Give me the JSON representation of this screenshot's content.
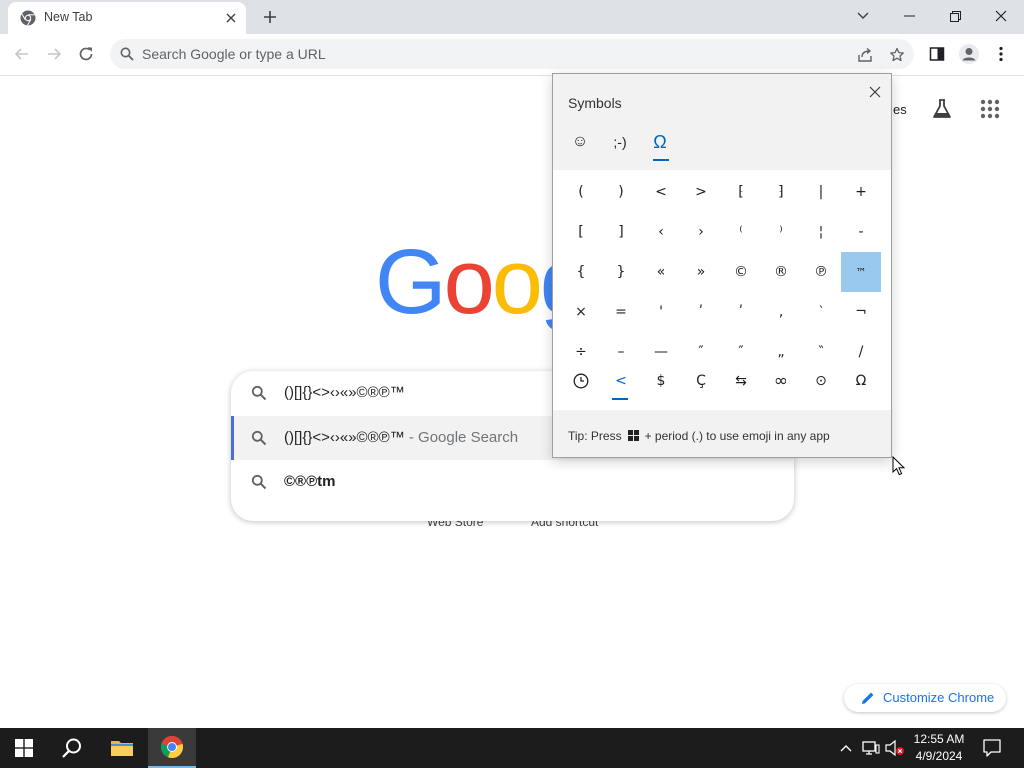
{
  "colors": {
    "accent_blue": "#1a73e8",
    "windows_accent": "#0067c0",
    "selected_symbol_bg": "#99c9ef",
    "google_blue": "#4285f4",
    "google_red": "#ea4335",
    "google_yellow": "#fbbc05",
    "taskbar_bg": "#1c1c1c"
  },
  "browser": {
    "tab_title": "New Tab",
    "omnibox_placeholder": "Search Google or type a URL"
  },
  "page": {
    "shortcuts_partial_label": "es",
    "logo_letters": [
      "G",
      "o",
      "o",
      "g"
    ],
    "web_store_label": "Web Store",
    "add_shortcut_label": "Add shortcut",
    "customize_label": "Customize Chrome"
  },
  "suggestions": [
    {
      "text": "()[]{}<>‹›«»©®℗™",
      "suffix": ""
    },
    {
      "text": "()[]{}<>‹›«»©®℗™",
      "suffix": " - Google Search"
    },
    {
      "text": "©®℗tm",
      "suffix": ""
    }
  ],
  "symbols_panel": {
    "title": "Symbols",
    "category_tabs": [
      {
        "icon": "smiley-icon",
        "label": "☺"
      },
      {
        "icon": "kaomoji-icon",
        "label": ";-)"
      },
      {
        "icon": "omega-icon",
        "label": "Ω"
      }
    ],
    "grid": [
      [
        "(",
        ")",
        "<",
        ">",
        "⁅",
        "⁆",
        "|",
        "+"
      ],
      [
        "[",
        "]",
        "‹",
        "›",
        "⁽",
        "⁾",
        "¦",
        "-"
      ],
      [
        "{",
        "}",
        "«",
        "»",
        "©",
        "®",
        "℗",
        "™"
      ],
      [
        "×",
        "=",
        "'",
        "ʹ",
        "ʹ",
        "‚",
        "‵",
        "¬"
      ],
      [
        "÷",
        "–",
        "—",
        "″",
        "″",
        "„",
        "‶",
        "/"
      ]
    ],
    "selected_symbol": "™",
    "subtabs": [
      {
        "icon": "clock-icon",
        "label": "🕒"
      },
      {
        "icon": "less-than-icon",
        "label": "<"
      },
      {
        "icon": "dollar-icon",
        "label": "$"
      },
      {
        "icon": "c-cedilla-icon",
        "label": "Ç"
      },
      {
        "icon": "arrows-icon",
        "label": "⇆"
      },
      {
        "icon": "infinity-icon",
        "label": "∞"
      },
      {
        "icon": "circled-dot-icon",
        "label": "⊙"
      },
      {
        "icon": "omega-icon",
        "label": "Ω"
      }
    ],
    "tip_prefix": "Tip: Press",
    "tip_suffix": "+ period (.) to use emoji in any app"
  },
  "taskbar": {
    "time": "12:55 AM",
    "date": "4/9/2024"
  }
}
